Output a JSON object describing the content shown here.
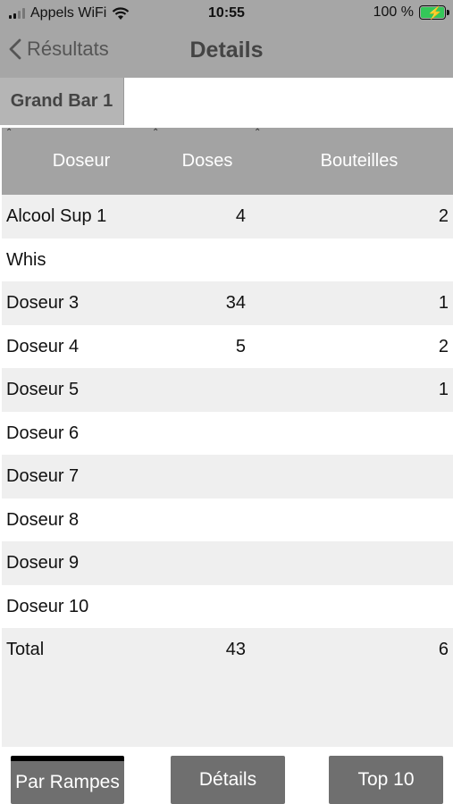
{
  "status": {
    "carrier": "Appels WiFi",
    "time": "10:55",
    "battery": "100 %"
  },
  "nav": {
    "back_label": "Résultats",
    "title": "Details"
  },
  "segment": {
    "label": "Grand Bar 1"
  },
  "table": {
    "headers": [
      "Doseur",
      "Doses",
      "Bouteilles"
    ],
    "rows": [
      {
        "name": "Alcool Sup 1",
        "doses": "4",
        "bouteilles": "2"
      },
      {
        "name": "Whis",
        "doses": "",
        "bouteilles": ""
      },
      {
        "name": "Doseur 3",
        "doses": "34",
        "bouteilles": "1"
      },
      {
        "name": "Doseur 4",
        "doses": "5",
        "bouteilles": "2"
      },
      {
        "name": "Doseur 5",
        "doses": "",
        "bouteilles": "1"
      },
      {
        "name": "Doseur 6",
        "doses": "",
        "bouteilles": ""
      },
      {
        "name": "Doseur 7",
        "doses": "",
        "bouteilles": ""
      },
      {
        "name": "Doseur 8",
        "doses": "",
        "bouteilles": ""
      },
      {
        "name": "Doseur 9",
        "doses": "",
        "bouteilles": ""
      },
      {
        "name": "Doseur 10",
        "doses": "",
        "bouteilles": ""
      },
      {
        "name": "Total",
        "doses": "43",
        "bouteilles": "6"
      }
    ]
  },
  "toolbar": {
    "par_rampes": "Par Rampes",
    "details": "Détails",
    "top10": "Top 10"
  },
  "colors": {
    "nav_bg": "#a6a6a6",
    "header_bg": "#a3a3a3",
    "button_bg": "#6f6f6f",
    "battery_fill": "#34c759"
  }
}
